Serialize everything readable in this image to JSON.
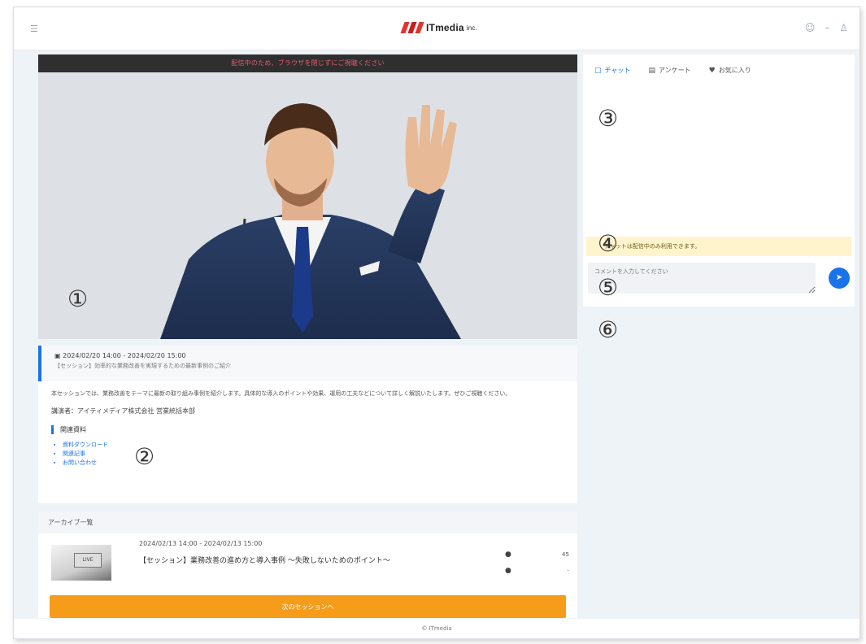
{
  "topbar": {
    "left_icon": "menu-icon",
    "logo_text": "ITmedia",
    "logo_suffix": "inc.",
    "right_icons": [
      "user-icon",
      "minimize-icon",
      "account-icon"
    ]
  },
  "player": {
    "banner_text": "配信中のため、ブラウザを閉じずにご視聴ください",
    "annotations": {
      "n1": "①",
      "n2": "②",
      "n3": "③",
      "n4": "④",
      "n5": "⑤",
      "n6": "⑥"
    }
  },
  "info": {
    "when": "2024/02/20 14:00 - 2024/02/20 15:00",
    "subtitle": "【セッション】効率的な業務改善を実現するための最新事例のご紹介",
    "description": "本セッションでは、業務改善をテーマに最新の取り組み事例を紹介します。具体的な導入のポイントや効果、運用の工夫などについて詳しく解説いたします。ぜひご視聴ください。",
    "speaker": "講演者：アイティメディア株式会社 営業統括本部",
    "related_heading": "関連資料",
    "related_links": [
      "資料ダウンロード",
      "関連記事",
      "お問い合わせ"
    ]
  },
  "archive": {
    "heading": "アーカイブ一覧",
    "item": {
      "thumb_label": "LIVE",
      "date": "2024/02/13 14:00 - 2024/02/13 15:00",
      "title": "【セッション】業務改善の進め方と導入事例 ～失敗しないためのポイント～",
      "stat_top": "45",
      "stat_bottom": "-"
    },
    "next_button": "次のセッションへ"
  },
  "side": {
    "tabs": [
      {
        "icon": "chat-icon",
        "label": "チャット"
      },
      {
        "icon": "question-icon",
        "label": "アンケート"
      },
      {
        "icon": "heart-icon",
        "label": "お気に入り"
      }
    ],
    "notice": "チャットは配信中のみ利用できます。",
    "composer_placeholder": "コメントを入力してください",
    "send_icon": "send-icon"
  },
  "footer": {
    "text": "© ITmedia"
  },
  "colors": {
    "accent": "#1a73e8",
    "cta": "#f59c1a",
    "banner": "#2f2f2f",
    "notice_bg": "#fff4cc"
  }
}
